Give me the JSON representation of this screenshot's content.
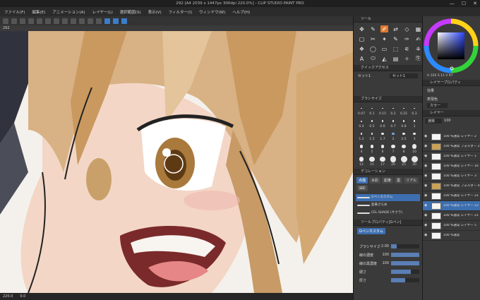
{
  "titlebar": {
    "title": "292 [A4 2039 x 1447px 300dpi 220.0%] - CLIP STUDIO PAINT PRO",
    "minimize": "—",
    "maximize": "☐",
    "close": "✕"
  },
  "menu": [
    "ファイル(F)",
    "編集(E)",
    "アニメーション(A)",
    "レイヤー(L)",
    "選択範囲(S)",
    "表示(V)",
    "フィルター(I)",
    "ウィンドウ(W)",
    "ヘルプ(H)"
  ],
  "canvas_tab": "292",
  "status": {
    "zoom": "220.0",
    "angle": "0.0"
  },
  "tool_panel": {
    "title": "ツール",
    "tools": [
      "✥",
      "✎",
      "✐",
      "⇄",
      "◇",
      "▦",
      "▢",
      "✂",
      "✦",
      "✎",
      "✑",
      "✍",
      "❖",
      "◯",
      "▭",
      "⬚",
      "⚟",
      "⁜",
      "A",
      "⬭",
      "◭",
      "▤",
      "✧",
      "⎘"
    ],
    "selected_tool_index": 2
  },
  "sub_tool": {
    "header": "クイックアクセス",
    "set_label": "セット1",
    "set_dropdown": "セット1"
  },
  "brush_size": {
    "header": "ブラシサイズ",
    "sizes": [
      "0.07",
      "0.1",
      "0.15",
      "0.2",
      "0.25",
      "0.3",
      "0.4",
      "0.5",
      "0.6",
      "0.7",
      "0.8",
      "1",
      "1.2",
      "1.5",
      "1.7",
      "2",
      "2.5",
      "3",
      "4",
      "5",
      "6",
      "7",
      "8",
      "10",
      "12",
      "15",
      "17",
      "20",
      "25",
      "30"
    ],
    "selected_size": "2"
  },
  "decoration": {
    "header": "デコレーション",
    "tags": [
      {
        "label": "点描",
        "active": true
      },
      {
        "label": "水彩",
        "active": false
      },
      {
        "label": "鉛筆",
        "active": false
      },
      {
        "label": "墨",
        "active": false
      },
      {
        "label": "リアル",
        "active": false
      },
      {
        "label": "油彩",
        "active": false
      }
    ],
    "strokes": [
      {
        "label": "Gペンカスタム",
        "selected": true
      },
      {
        "label": "鉛筆ざらめ",
        "selected": false
      },
      {
        "label": "CEL SHADE (サクラ)",
        "selected": false
      }
    ]
  },
  "tool_property": {
    "header": "ツールプロパティ[Gペン]",
    "preset": "Gペンカスタム",
    "rows": [
      {
        "label": "ブラシサイズ",
        "value": "2.00",
        "fill": 0.2
      },
      {
        "label": "線の濃度",
        "value": "100",
        "fill": 1.0
      },
      {
        "label": "線の黒濃度",
        "value": "100",
        "fill": 1.0
      },
      {
        "label": "硬さ",
        "value": "",
        "fill": 0.7
      },
      {
        "label": "厚さ",
        "value": "",
        "fill": 0.5
      }
    ]
  },
  "color_panel": {
    "h": "220",
    "s": "11",
    "v": "97",
    "hsv_label": "H 220 S 11 V 97"
  },
  "layer_property": {
    "header": "レイヤープロパティ",
    "effect_label": "効果",
    "expression_label": "表現色",
    "expression_value": "カラー"
  },
  "layers_panel": {
    "header": "レイヤー",
    "blend": "通常",
    "opacity": "100",
    "layers": [
      {
        "name": "100 %通常 レイヤー 2",
        "selected": false,
        "folder": false
      },
      {
        "name": "100 %通常 フォルダー 2",
        "selected": false,
        "folder": true
      },
      {
        "name": "100 %通常 レイヤー 1",
        "selected": false,
        "folder": false
      },
      {
        "name": "100 %通常 レイヤー 16",
        "selected": false,
        "folder": false
      },
      {
        "name": "100 %通常 レイヤー 3",
        "selected": false,
        "folder": false
      },
      {
        "name": "100 %通常 フォルダー 4",
        "selected": false,
        "folder": true
      },
      {
        "name": "100 %通常 レイヤー 22",
        "selected": false,
        "folder": false
      },
      {
        "name": "100 %通常 レイヤー 23",
        "selected": true,
        "folder": false
      },
      {
        "name": "100 %通常 レイヤー 21",
        "selected": false,
        "folder": false
      },
      {
        "name": "100 %通常 レイヤー 5",
        "selected": false,
        "folder": false
      },
      {
        "name": "100 %通常",
        "selected": false,
        "folder": false
      }
    ]
  }
}
